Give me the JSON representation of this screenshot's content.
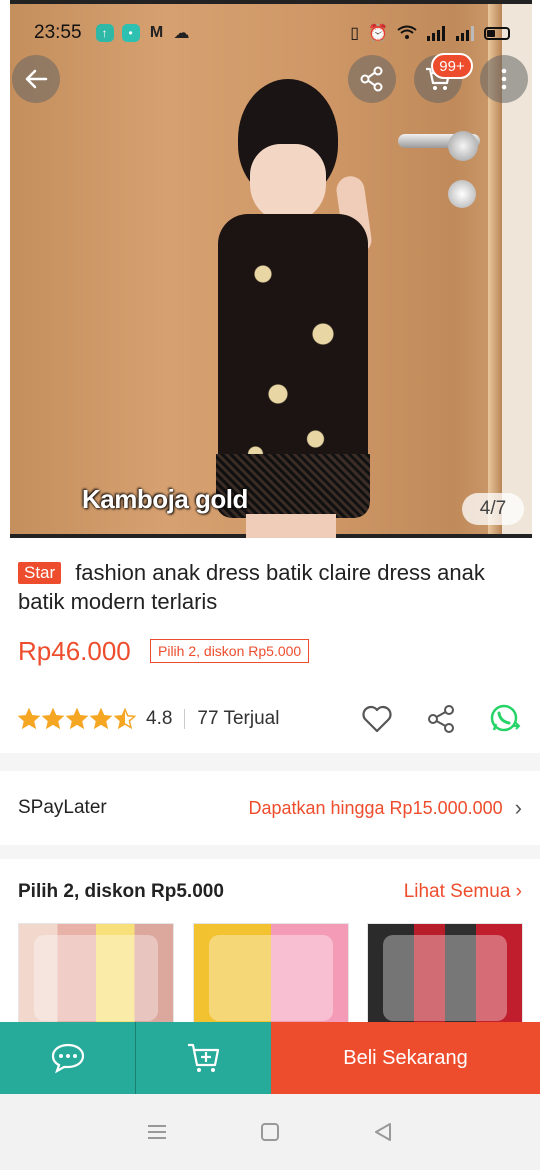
{
  "status_bar": {
    "time": "23:55"
  },
  "hero": {
    "caption": "Kamboja gold",
    "image_counter": "4/7",
    "cart_badge": "99+"
  },
  "product": {
    "tag": "Star",
    "title": "fashion anak dress batik claire dress anak batik modern terlaris",
    "price": "Rp46.000",
    "promo": "Pilih 2, diskon Rp5.000",
    "rating": "4.8",
    "rating_stars": 4.5,
    "sold": "77 Terjual"
  },
  "spaylater": {
    "label": "SPayLater",
    "promo": "Dapatkan hingga Rp15.000.000"
  },
  "bundle": {
    "title": "Pilih 2, diskon Rp5.000",
    "see_all": "Lihat Semua"
  },
  "bottom_bar": {
    "buy_label": "Beli Sekarang"
  },
  "colors": {
    "accent": "#ee4d2d",
    "teal": "#26aa99",
    "whatsapp": "#25d366"
  },
  "icons": [
    "back-arrow-icon",
    "share-icon",
    "cart-icon",
    "more-vert-icon",
    "heart-icon",
    "share-icon",
    "whatsapp-icon",
    "chat-icon",
    "add-to-cart-icon",
    "menu-icon",
    "home-icon",
    "back-icon"
  ]
}
